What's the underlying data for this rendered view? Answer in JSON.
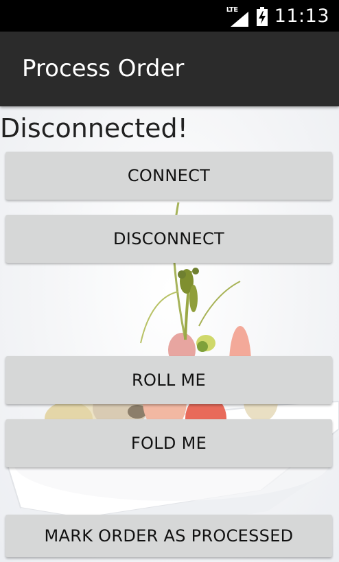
{
  "status_bar": {
    "network_label": "LTE",
    "time": "11:13",
    "icons": [
      "signal-icon",
      "battery-charging-icon"
    ]
  },
  "app_bar": {
    "title": "Process Order"
  },
  "connection_status": "Disconnected!",
  "buttons": {
    "connect": "CONNECT",
    "disconnect": "DISCONNECT",
    "roll": "ROLL ME",
    "fold": "FOLD ME",
    "mark_processed": "MARK ORDER AS PROCESSED"
  },
  "colors": {
    "status_bar_bg": "#000000",
    "app_bar_bg": "#2b2b2b",
    "button_bg": "#d6d7d7",
    "text": "#212121"
  }
}
